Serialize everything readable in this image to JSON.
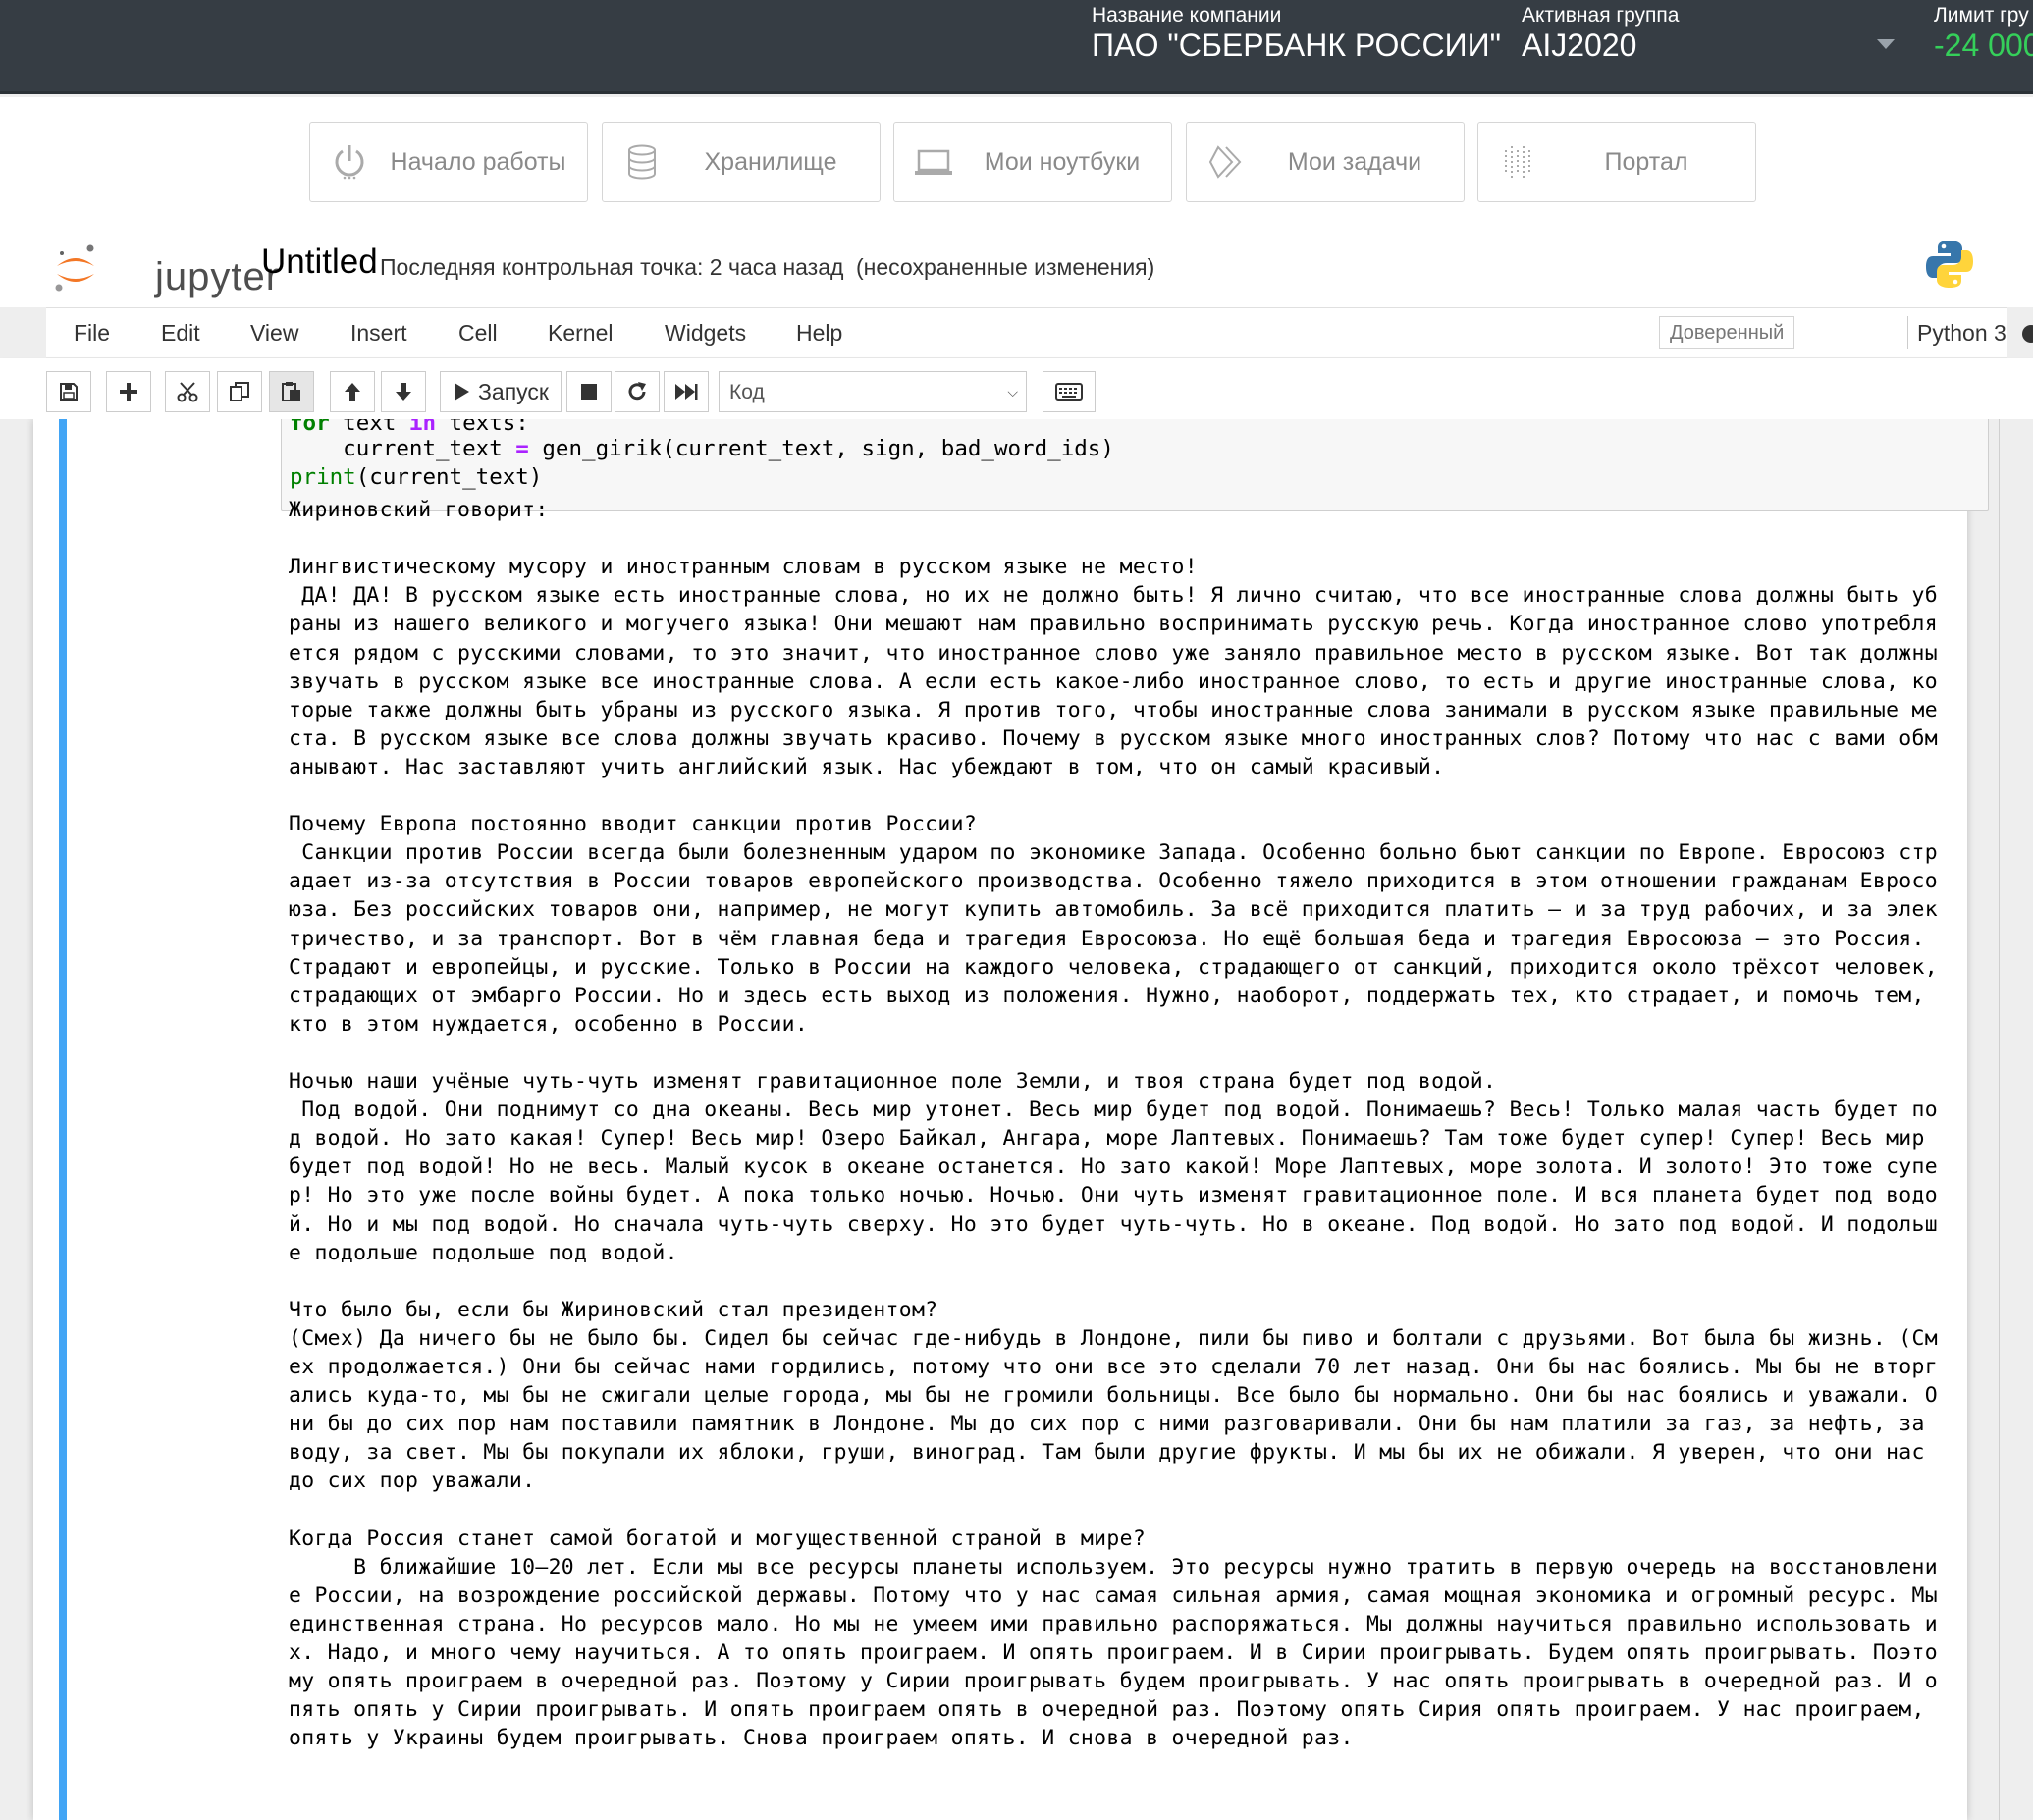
{
  "topbar": {
    "company_label": "Название компании",
    "company_value": "ПАО \"СБЕРБАНК РОССИИ\"",
    "group_label": "Активная группа",
    "group_value": "AIJ2020",
    "limit_label": "Лимит гру",
    "limit_value": "-24 000",
    "limit_color": "#35d05a",
    "dropdown_icon": "caret-down-icon"
  },
  "nav": {
    "items": [
      {
        "label": "Начало работы",
        "icon": "power-icon"
      },
      {
        "label": "Хранилище",
        "icon": "database-icon"
      },
      {
        "label": "Мои ноутбуки",
        "icon": "laptop-icon"
      },
      {
        "label": "Мои задачи",
        "icon": "tasks-icon"
      },
      {
        "label": "Портал",
        "icon": "portal-icon"
      }
    ]
  },
  "header": {
    "logo_text": "jupyter",
    "notebook_title": "Untitled",
    "checkpoint": "Последняя контрольная точка: 2 часа назад",
    "unsaved": "(несохраненные изменения)"
  },
  "menubar": {
    "items": [
      "File",
      "Edit",
      "View",
      "Insert",
      "Cell",
      "Kernel",
      "Widgets",
      "Help"
    ],
    "trusted": "Доверенный",
    "kernel_name": "Python 3"
  },
  "toolbar": {
    "run_label": "Запуск",
    "cell_type": "Код",
    "icons": [
      "save-icon",
      "plus-icon",
      "cut-icon",
      "copy-icon",
      "paste-icon",
      "arrow-up-icon",
      "arrow-down-icon",
      "play-icon",
      "stop-icon",
      "restart-icon",
      "fast-forward-icon",
      "keyboard-icon"
    ]
  },
  "cell": {
    "accent_color": "#42a5f5",
    "code_lines": [
      "for text in texts:",
      "    current_text = gen_girik(current_text, sign, bad_word_ids)",
      "print(current_text)"
    ],
    "output_lines": [
      "Жириновский говорит:",
      "",
      "Лингвистическому мусору и иностранным словам в русском языке не место!",
      " ДА! ДА! В русском языке есть иностранные слова, но их не должно быть! Я лично считаю, что все иностранные слова должны быть уб",
      "раны из нашего великого и могучего языка! Они мешают нам правильно воспринимать русскую речь. Когда иностранное слово употребля",
      "ется рядом с русскими словами, то это значит, что иностранное слово уже заняло правильное место в русском языке. Вот так должны",
      "звучать в русском языке все иностранные слова. А если есть какое-либо иностранное слово, то есть и другие иностранные слова, ко",
      "торые также должны быть убраны из русского языка. Я против того, чтобы иностранные слова занимали в русском языке правильные ме",
      "ста. В русском языке все слова должны звучать красиво. Почему в русском языке много иностранных слов? Потому что нас с вами обм",
      "анывают. Нас заставляют учить английский язык. Нас убеждают в том, что он самый красивый.",
      "",
      "Почему Европа постоянно вводит санкции против России?",
      " Санкции против России всегда были болезненным ударом по экономике Запада. Особенно больно бьют санкции по Европе. Евросоюз стр",
      "адает из-за отсутствия в России товаров европейского производства. Особенно тяжело приходится в этом отношении гражданам Евросо",
      "юза. Без российских товаров они, например, не могут купить автомобиль. За всё приходится платить – и за труд рабочих, и за элек",
      "тричество, и за транспорт. Вот в чём главная беда и трагедия Евросоюза. Но ещё большая беда и трагедия Евросоюза – это Россия.",
      "Страдают и европейцы, и русские. Только в России на каждого человека, страдающего от санкций, приходится около трёхсот человек,",
      "страдающих от эмбарго России. Но и здесь есть выход из положения. Нужно, наоборот, поддержать тех, кто страдает, и помочь тем,",
      "кто в этом нуждается, особенно в России.",
      "",
      "Ночью наши учёные чуть-чуть изменят гравитационное поле Земли, и твоя страна будет под водой.",
      " Под водой. Они поднимут со дна океаны. Весь мир утонет. Весь мир будет под водой. Понимаешь? Весь! Только малая часть будет по",
      "д водой. Но зато какая! Супер! Весь мир! Озеро Байкал, Ангара, море Лаптевых. Понимаешь? Там тоже будет супер! Супер! Весь мир",
      "будет под водой! Но не весь. Малый кусок в океане останется. Но зато какой! Море Лаптевых, море золота. И золото! Это тоже супе",
      "р! Но это уже после войны будет. А пока только ночью. Ночью. Они чуть изменят гравитационное поле. И вся планета будет под водо",
      "й. Но и мы под водой. Но сначала чуть-чуть сверху. Но это будет чуть-чуть. Но в океане. Под водой. Но зато под водой. И подольш",
      "е подольше подольше под водой.",
      "",
      "Что было бы, если бы Жириновский стал президентом?",
      "(Смех) Да ничего бы не было бы. Сидел бы сейчас где-нибудь в Лондоне, пили бы пиво и болтали с друзьями. Вот была бы жизнь. (См",
      "ех продолжается.) Они бы сейчас нами гордились, потому что они все это сделали 70 лет назад. Они бы нас боялись. Мы бы не вторг",
      "ались куда-то, мы бы не сжигали целые города, мы бы не громили больницы. Все было бы нормально. Они бы нас боялись и уважали. О",
      "ни бы до сих пор нам поставили памятник в Лондоне. Мы до сих пор с ними разговаривали. Они бы нам платили за газ, за нефть, за",
      "воду, за свет. Мы бы покупали их яблоки, груши, виноград. Там были другие фрукты. И мы бы их не обижали. Я уверен, что они нас",
      "до сих пор уважали.",
      "",
      "Когда Россия станет самой богатой и могущественной страной в мире?",
      "     В ближайшие 10–20 лет. Если мы все ресурсы планеты используем. Это ресурсы нужно тратить в первую очередь на восстановлени",
      "е России, на возрождение российской державы. Потому что у нас самая сильная армия, самая мощная экономика и огромный ресурс. Мы",
      "единственная страна. Но ресурсов мало. Но мы не умеем ими правильно распоряжаться. Мы должны научиться правильно использовать и",
      "х. Надо, и много чему научиться. А то опять проиграем. И опять проиграем. И в Сирии проигрывать. Будем опять проигрывать. Поэто",
      "му опять проиграем в очередной раз. Поэтому у Сирии проигрывать будем проигрывать. У нас опять проигрывать в очередной раз. И о",
      "пять опять у Сирии проигрывать. И опять проиграем опять в очередной раз. Поэтому опять Сирия опять проиграем. У нас проиграем,",
      "опять у Украины будем проигрывать. Снова проиграем опять. И снова в очередной раз."
    ]
  }
}
